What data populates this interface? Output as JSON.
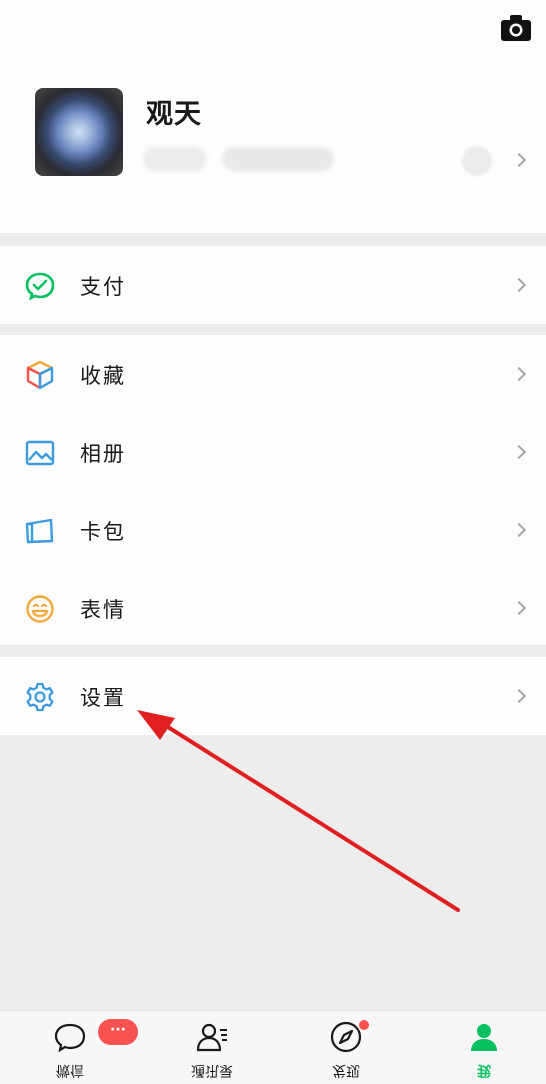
{
  "profile": {
    "nickname": "观天",
    "icons": {
      "camera": "camera-icon",
      "qr": "qr-code-icon"
    }
  },
  "menu": {
    "pay": {
      "label": "支付",
      "icon": "wechat-pay-icon",
      "color": "#07c160"
    },
    "favorites": {
      "label": "收藏",
      "icon": "cube-icon"
    },
    "album": {
      "label": "相册",
      "icon": "image-icon",
      "color": "#3b9bde"
    },
    "cards": {
      "label": "卡包",
      "icon": "card-icon",
      "color": "#3b9bde"
    },
    "stickers": {
      "label": "表情",
      "icon": "smiley-icon",
      "color": "#f3a839"
    },
    "settings": {
      "label": "设置",
      "icon": "gear-icon",
      "color": "#3b9bde"
    }
  },
  "tabbar": {
    "chats": {
      "label": "微信",
      "badge": "···"
    },
    "contacts": {
      "label": "通讯录"
    },
    "discover": {
      "label": "发现"
    },
    "me": {
      "label": "我",
      "active": true,
      "color": "#07c160"
    }
  },
  "annotation": {
    "arrow_color": "#e02020"
  }
}
